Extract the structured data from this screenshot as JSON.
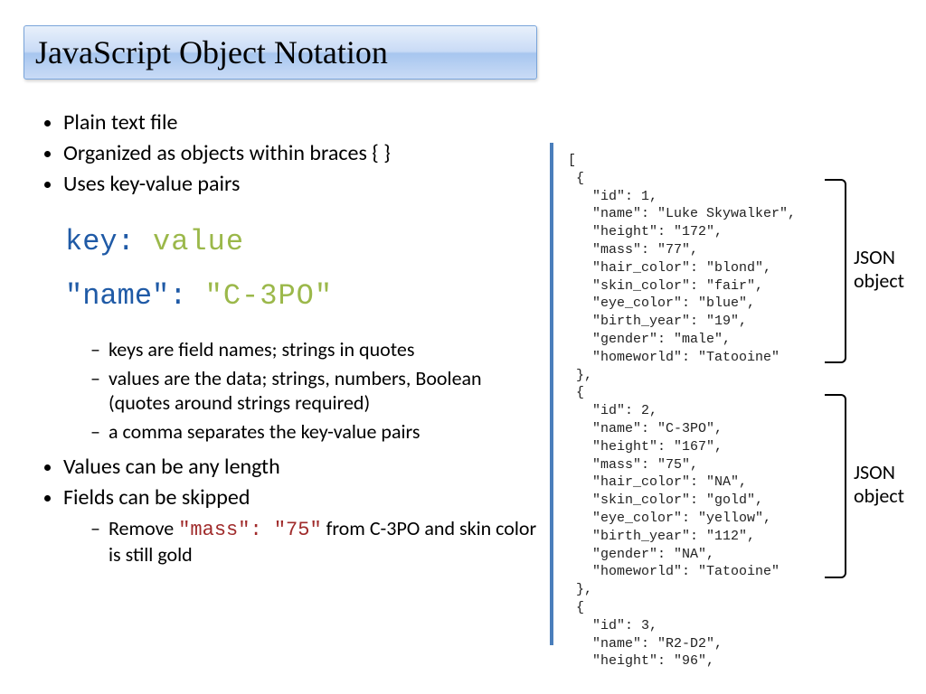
{
  "title": "JavaScript Object Notation",
  "bullets": {
    "b1": "Plain text file",
    "b2": "Organized as objects within braces { }",
    "b3": "Uses key-value pairs",
    "kv1_key": "key:",
    "kv1_val": " value",
    "kv2_key": "\"name\":",
    "kv2_val": " \"C-3PO\"",
    "sub1": "keys are field names; strings in quotes",
    "sub2": "values are the data; strings, numbers, Boolean (quotes around strings required)",
    "sub3": "a comma separates the key-value pairs",
    "b4": "Values can be any length",
    "b5": "Fields can be skipped",
    "sub4_pre": "Remove ",
    "sub4_code": "\"mass\": \"75\"",
    "sub4_post": " from C-3PO and skin color is still gold"
  },
  "json_example": "[\n {\n   \"id\": 1,\n   \"name\": \"Luke Skywalker\",\n   \"height\": \"172\",\n   \"mass\": \"77\",\n   \"hair_color\": \"blond\",\n   \"skin_color\": \"fair\",\n   \"eye_color\": \"blue\",\n   \"birth_year\": \"19\",\n   \"gender\": \"male\",\n   \"homeworld\": \"Tatooine\"\n },\n {\n   \"id\": 2,\n   \"name\": \"C-3PO\",\n   \"height\": \"167\",\n   \"mass\": \"75\",\n   \"hair_color\": \"NA\",\n   \"skin_color\": \"gold\",\n   \"eye_color\": \"yellow\",\n   \"birth_year\": \"112\",\n   \"gender\": \"NA\",\n   \"homeworld\": \"Tatooine\"\n },\n {\n   \"id\": 3,\n   \"name\": \"R2-D2\",\n   \"height\": \"96\",",
  "brace_label": "JSON object"
}
